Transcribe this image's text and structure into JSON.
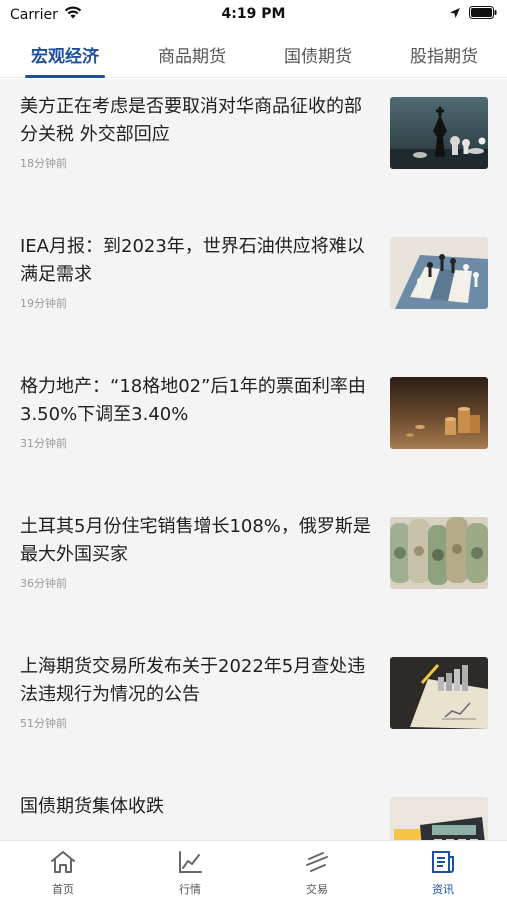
{
  "status_bar": {
    "carrier": "Carrier",
    "time": "4:19 PM"
  },
  "tabs": [
    {
      "label": "宏观经济",
      "active": true
    },
    {
      "label": "商品期货",
      "active": false
    },
    {
      "label": "国债期货",
      "active": false
    },
    {
      "label": "股指期货",
      "active": false
    }
  ],
  "news": [
    {
      "title": "美方正在考虑是否要取消对华商品征收的部分关税 外交部回应",
      "time": "18分钟前",
      "image": "chess-king-pieces"
    },
    {
      "title": "IEA月报：到2023年，世界石油供应将难以满足需求",
      "time": "19分钟前",
      "image": "chess-board"
    },
    {
      "title": "格力地产：“18格地02”后1年的票面利率由3.50%下调至3.40%",
      "time": "31分钟前",
      "image": "coin-stacks"
    },
    {
      "title": "土耳其5月份住宅销售增长108%，俄罗斯是最大外国买家",
      "time": "36分钟前",
      "image": "rolled-banknotes"
    },
    {
      "title": "上海期货交易所发布关于2022年5月查处违法违规行为情况的公告",
      "time": "51分钟前",
      "image": "notebook-coins"
    },
    {
      "title": "国债期货集体收跌",
      "time": "",
      "image": "calculator"
    }
  ],
  "bottom_nav": [
    {
      "label": "首页",
      "icon": "home-icon",
      "active": false
    },
    {
      "label": "行情",
      "icon": "chart-line-icon",
      "active": false
    },
    {
      "label": "交易",
      "icon": "trade-icon",
      "active": false
    },
    {
      "label": "资讯",
      "icon": "news-icon",
      "active": true
    }
  ],
  "colors": {
    "accent": "#1f4f9f",
    "list_bg": "#f4f4f4"
  }
}
